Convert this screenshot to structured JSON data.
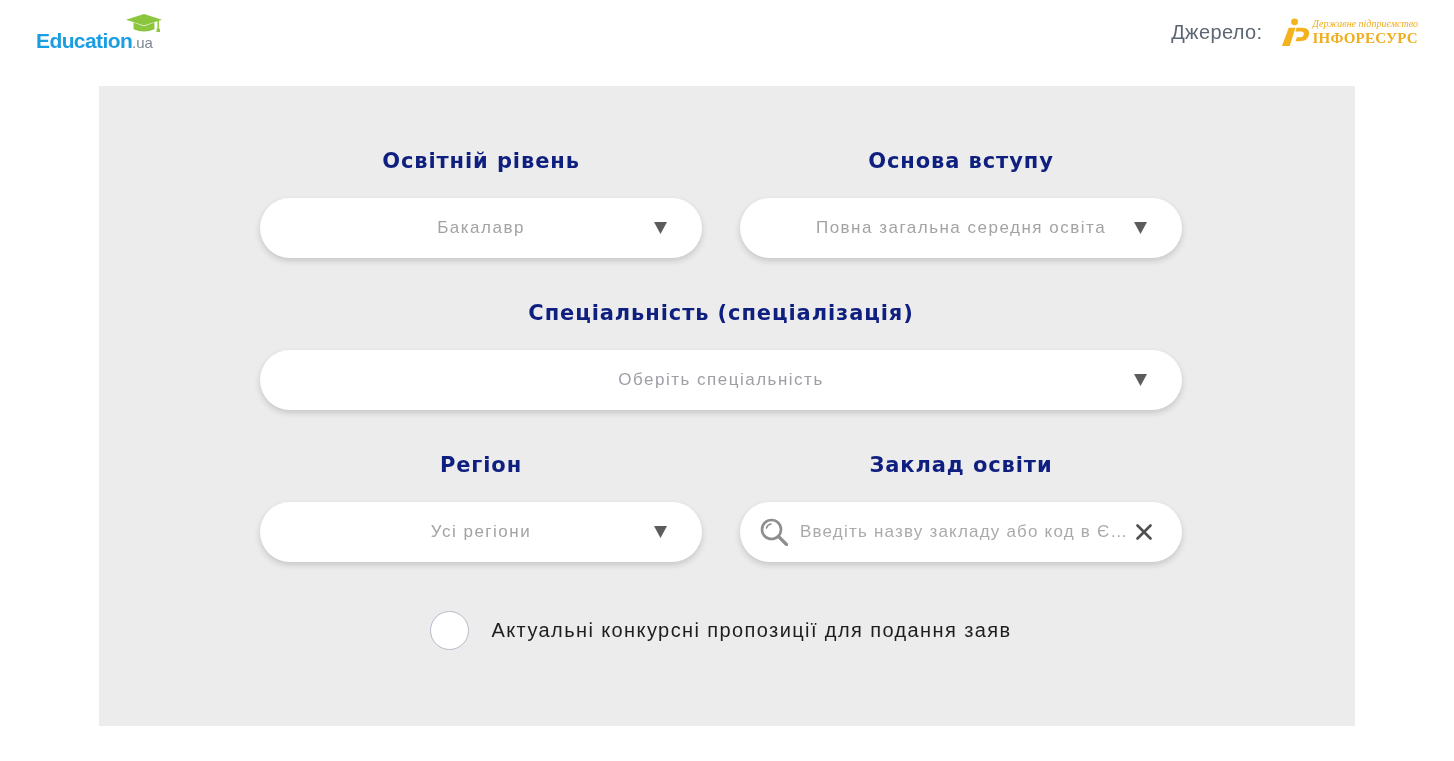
{
  "header": {
    "logo": {
      "name": "Education",
      "domain": ".ua"
    },
    "source": {
      "label": "Джерело:",
      "publisher_tagline": "Державне підприємство",
      "publisher_name": "ІНФОРЕСУРС"
    }
  },
  "form": {
    "rows": [
      [
        {
          "kind": "select",
          "label": "Освітній рівень",
          "value": "Бакалавр"
        },
        {
          "kind": "select",
          "label": "Основа вступу",
          "value": "Повна загальна середня освіта"
        }
      ],
      [
        {
          "kind": "select",
          "label": "Спеціальність (спеціалізація)",
          "placeholder": "Оберіть спеціальність"
        }
      ],
      [
        {
          "kind": "select",
          "label": "Регіон",
          "value": "Усі регіони"
        },
        {
          "kind": "search",
          "label": "Заклад освіти",
          "placeholder": "Введіть назву закладу або код в Є…"
        }
      ]
    ],
    "checkbox": {
      "label": "Актуальні конкурсні пропозиції для подання заяв",
      "checked": false
    }
  }
}
